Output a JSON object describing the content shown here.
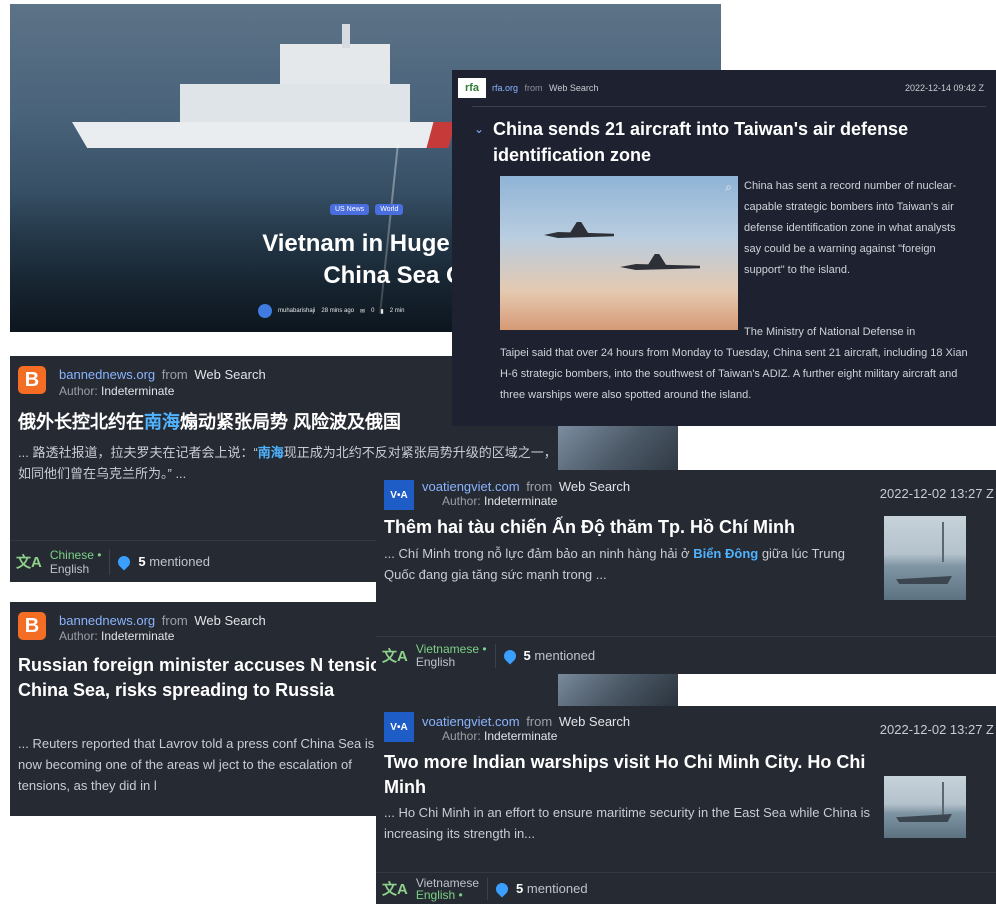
{
  "hero": {
    "tags": [
      "US News",
      "World"
    ],
    "title_line1": "Vietnam in Huge Push to Br",
    "title_line2": "China Sea Outpo",
    "author": "muhabarishaji",
    "time": "28 mins ago",
    "comments": "0",
    "read": "2 min"
  },
  "rfa": {
    "logo": "rfa",
    "site": "rfa.org",
    "from": "from",
    "via": "Web Search",
    "date": "2022-12-14 09:42 Z",
    "title": "China sends 21 aircraft into Taiwan's air defense identification zone",
    "para1": "China has sent a record number of nuclear-capable strategic bombers into Taiwan's air defense identification zone in what analysts say could be a warning against \"foreign support\" to the island.",
    "para2_lead": "The Ministry of National Defense in",
    "para2_rest": "Taipei said that over 24 hours from Monday to Tuesday, China sent 21 aircraft, including 18 Xian H-6 strategic bombers, into the southwest of Taiwan's ADIZ. A further eight military aircraft and three warships were also spotted around the island."
  },
  "card1": {
    "site": "bannednews.org",
    "from": "from",
    "via": "Web Search",
    "author_label": "Author:",
    "author": "Indeterminate",
    "headline_a": "俄外长控北约在",
    "headline_hl": "南海",
    "headline_b": "煽动紧张局势 风险波及俄国",
    "snippet_a": "... 路透社报道，拉夫罗夫在记者会上说：“",
    "snippet_hl": "南海",
    "snippet_b": "现正成为北约不反对紧张局势升级的区域之一，如同他们曾在乌克兰所为。” ...",
    "lang_primary": "Chinese •",
    "lang_secondary": "English",
    "mention_count": "5",
    "mention_label": "mentioned"
  },
  "card2": {
    "site": "bannednews.org",
    "from": "from",
    "via": "Web Search",
    "author_label": "Author:",
    "author": "Indeterminate",
    "headline": "Russian foreign minister accuses N tensions in South China Sea, risks spreading to Russia",
    "snippet": "... Reuters reported that Lavrov told a press conf China Sea is now becoming one of the areas wl ject to the escalation of tensions, as they did in l"
  },
  "card3": {
    "logo": "V•A",
    "site": "voatiengviet.com",
    "from": "from",
    "via": "Web Search",
    "author_label": "Author:",
    "author": "Indeterminate",
    "date": "2022-12-02 13:27 Z",
    "headline": "Thêm hai tàu chiến Ấn Độ thăm Tp. Hồ Chí Minh",
    "snippet_a": "... Chí Minh trong nỗ lực đảm bảo an ninh hàng hải ở ",
    "snippet_hl": "Biển Đông",
    "snippet_b": " giữa lúc Trung Quốc đang gia tăng sức mạnh trong ...",
    "lang_primary": "Vietnamese •",
    "lang_secondary": "English",
    "mention_count": "5",
    "mention_label": "mentioned"
  },
  "card4": {
    "logo": "V•A",
    "site": "voatiengviet.com",
    "from": "from",
    "via": "Web Search",
    "author_label": "Author:",
    "author": "Indeterminate",
    "date": "2022-12-02 13:27 Z",
    "headline": "Two more Indian warships visit Ho Chi Minh City. Ho Chi Minh",
    "snippet": "... Ho Chi Minh in an effort to ensure maritime security in the East Sea while China is increasing its strength in...",
    "lang_primary": "Vietnamese",
    "lang_secondary": "English •",
    "mention_count": "5",
    "mention_label": "mentioned"
  }
}
